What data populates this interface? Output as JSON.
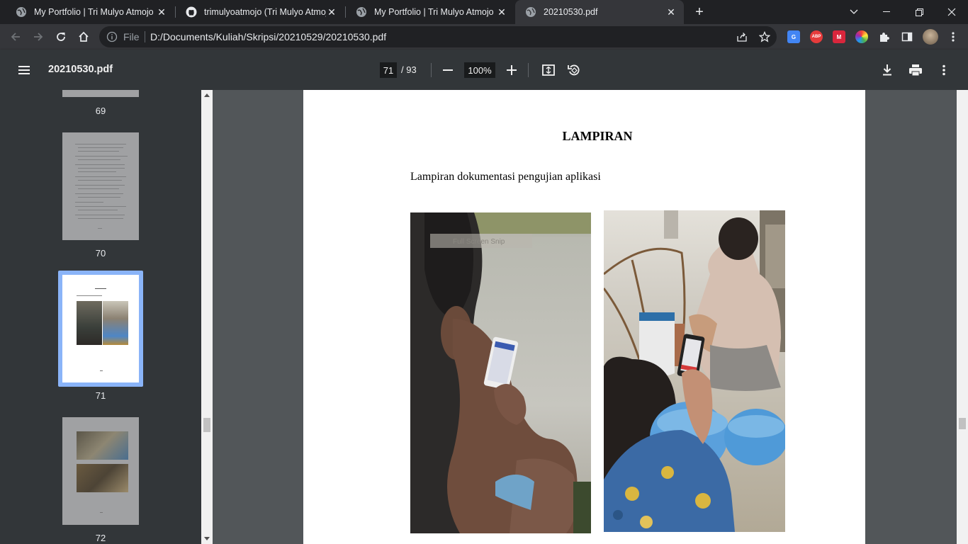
{
  "browser": {
    "tabs": [
      {
        "title": "My Portfolio | Tri Mulyo Atmojo",
        "icon": "globe-icon",
        "active": false
      },
      {
        "title": "trimulyoatmojo (Tri Mulyo Atmojo)",
        "icon": "github-icon",
        "active": false
      },
      {
        "title": "My Portfolio | Tri Mulyo Atmojo",
        "icon": "globe-icon",
        "active": false
      },
      {
        "title": "20210530.pdf",
        "icon": "globe-icon",
        "active": true
      }
    ],
    "omnibox": {
      "scheme_label": "File",
      "url": "D:/Documents/Kuliah/Skripsi/20210529/20210530.pdf"
    },
    "extensions": [
      {
        "name": "google-translate-extension-icon",
        "label": "G",
        "color": "#4285f4"
      },
      {
        "name": "adblock-plus-extension-icon",
        "label": "ABP",
        "color": "#e63b3b"
      },
      {
        "name": "mendeley-extension-icon",
        "label": "M",
        "color": "#d9263c"
      },
      {
        "name": "color-picker-extension-icon",
        "label": "",
        "color": "#9c27b0"
      }
    ]
  },
  "pdf": {
    "filename": "20210530.pdf",
    "current_page": "71",
    "page_total": "/ 93",
    "zoom": "100%"
  },
  "sidebar": {
    "thumbnails": [
      {
        "page": "69"
      },
      {
        "page": "70"
      },
      {
        "page": "71",
        "selected": true
      },
      {
        "page": "72"
      }
    ]
  },
  "page": {
    "heading": "LAMPIRAN",
    "caption": "Lampiran dokumentasi pengujian aplikasi",
    "photo_overlay_text": "Full Screen Snip"
  },
  "colors": {
    "accent": "#8ab4f8",
    "chrome_dark": "#202124",
    "chrome_mid": "#35363a",
    "pdf_toolbar": "#323639",
    "viewer_bg": "#525659"
  }
}
